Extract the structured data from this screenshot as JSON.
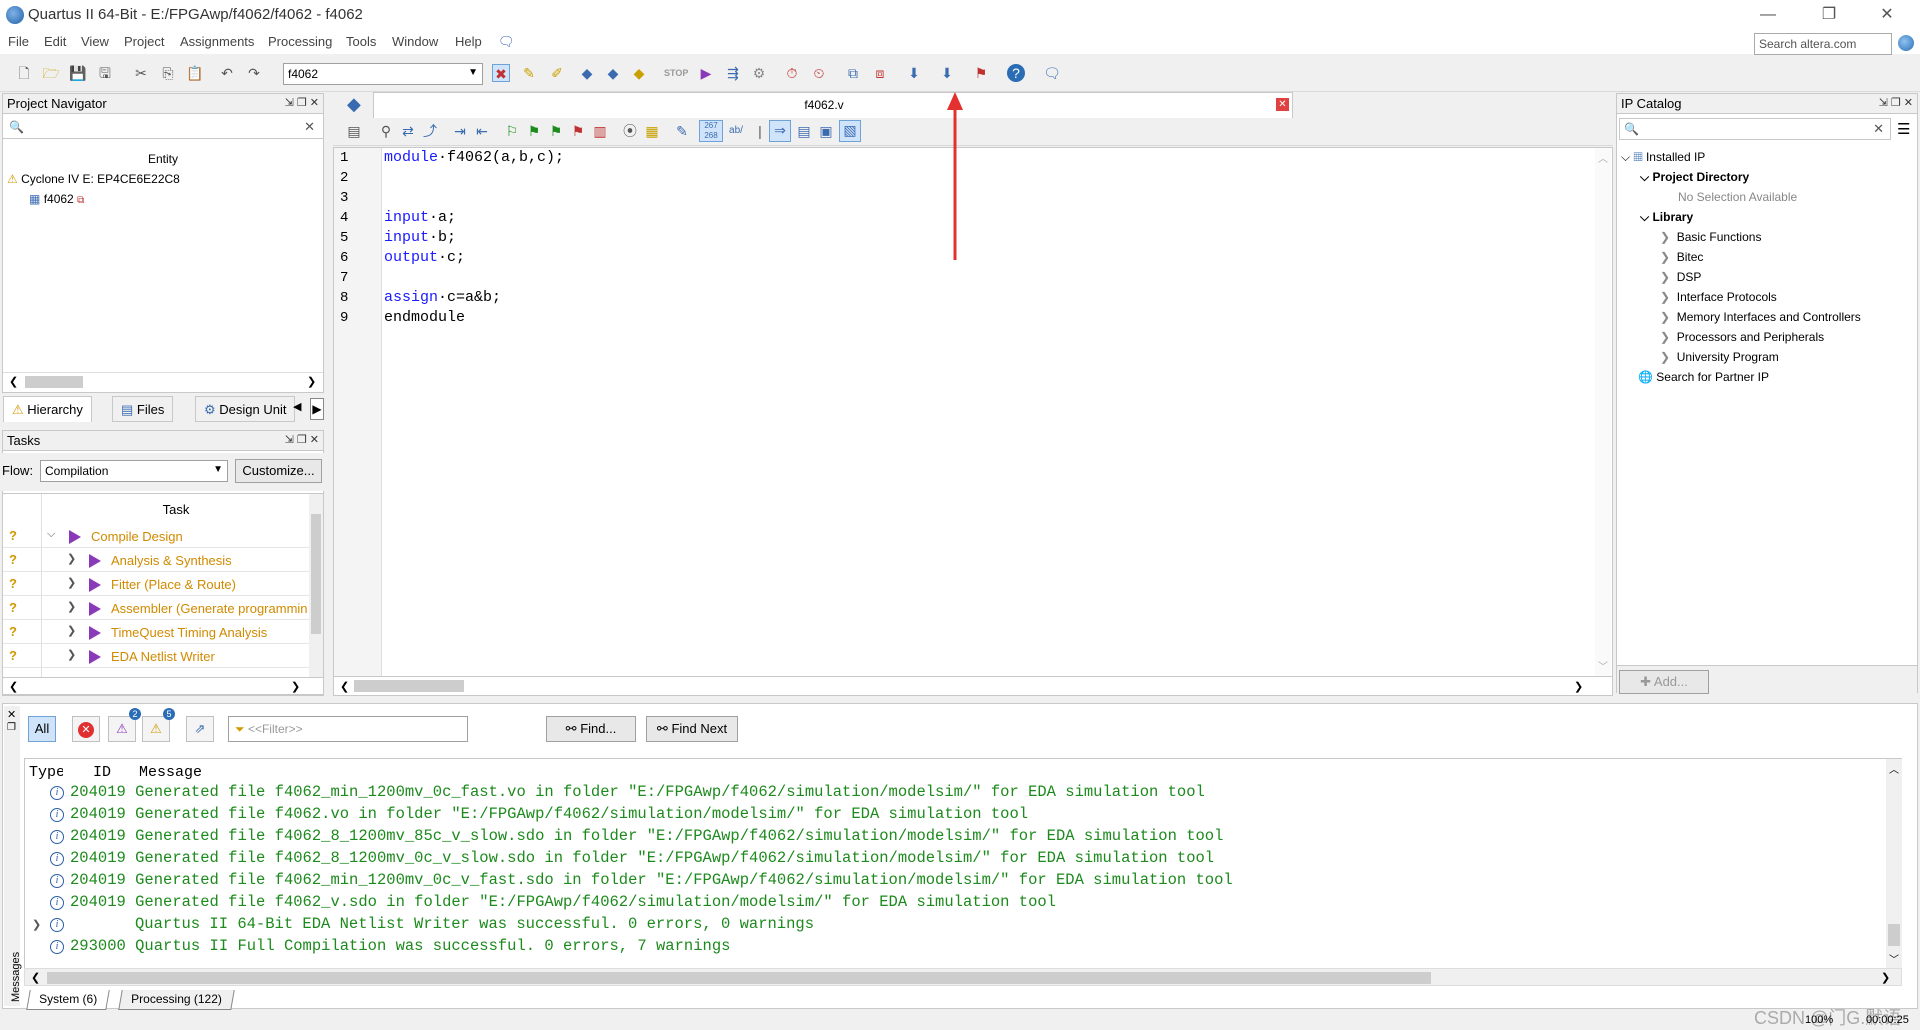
{
  "window": {
    "title": "Quartus II 64-Bit - E:/FPGAwp/f4062/f4062 - f4062",
    "minimize": "—",
    "restore": "❐",
    "close": "✕"
  },
  "menu": [
    "File",
    "Edit",
    "View",
    "Project",
    "Assignments",
    "Processing",
    "Tools",
    "Window",
    "Help"
  ],
  "search": {
    "placeholder": "Search altera.com"
  },
  "toolbar": {
    "revision": "f4062"
  },
  "project_navigator": {
    "title": "Project Navigator",
    "column": "Entity",
    "device": "Cyclone IV E: EP4CE6E22C8",
    "top_entity": "f4062",
    "tabs": [
      "Hierarchy",
      "Files",
      "Design Unit"
    ]
  },
  "tasks": {
    "title": "Tasks",
    "flow_label": "Flow:",
    "flow_value": "Compilation",
    "customize": "Customize...",
    "column": "Task",
    "items": [
      {
        "label": "Compile Design",
        "status": "?"
      },
      {
        "label": "Analysis & Synthesis",
        "status": "?"
      },
      {
        "label": "Fitter (Place & Route)",
        "status": "?"
      },
      {
        "label": "Assembler (Generate programmin",
        "status": "?"
      },
      {
        "label": "TimeQuest Timing Analysis",
        "status": "?"
      },
      {
        "label": "EDA Netlist Writer",
        "status": "?"
      }
    ]
  },
  "editor": {
    "tab": "f4062.v",
    "lines": [
      {
        "n": "1",
        "kw": "module",
        "rest": "·f4062(a,b,c);"
      },
      {
        "n": "2",
        "kw": "",
        "rest": ""
      },
      {
        "n": "3",
        "kw": "",
        "rest": ""
      },
      {
        "n": "4",
        "kw": "input",
        "rest": "·a;"
      },
      {
        "n": "5",
        "kw": "input",
        "rest": "·b;"
      },
      {
        "n": "6",
        "kw": "output",
        "rest": "·c;"
      },
      {
        "n": "7",
        "kw": "",
        "rest": ""
      },
      {
        "n": "8",
        "kw": "assign",
        "rest": "·c=a&b;"
      },
      {
        "n": "9",
        "kw": "",
        "rest": "endmodule"
      }
    ]
  },
  "ip_catalog": {
    "title": "IP Catalog",
    "installed": "Installed IP",
    "project_directory": "Project Directory",
    "no_selection": "No Selection Available",
    "library": "Library",
    "categories": [
      "Basic Functions",
      "Bitec",
      "DSP",
      "Interface Protocols",
      "Memory Interfaces and Controllers",
      "Processors and Peripherals",
      "University Program"
    ],
    "partner": "Search for Partner IP",
    "add": "Add..."
  },
  "messages": {
    "side_label": "Messages",
    "filter_all": "All",
    "badge_warn_crit": "2",
    "badge_warn": "5",
    "filter_placeholder": "<<Filter>>",
    "find": "Find...",
    "find_next": "Find Next",
    "columns": [
      "Type",
      "ID",
      "Message"
    ],
    "rows": [
      {
        "id": "204019",
        "msg": "Generated file f4062_min_1200mv_0c_fast.vo in folder \"E:/FPGAwp/f4062/simulation/modelsim/\" for EDA simulation tool"
      },
      {
        "id": "204019",
        "msg": "Generated file f4062.vo in folder \"E:/FPGAwp/f4062/simulation/modelsim/\" for EDA simulation tool"
      },
      {
        "id": "204019",
        "msg": "Generated file f4062_8_1200mv_85c_v_slow.sdo in folder \"E:/FPGAwp/f4062/simulation/modelsim/\" for EDA simulation tool"
      },
      {
        "id": "204019",
        "msg": "Generated file f4062_8_1200mv_0c_v_slow.sdo in folder \"E:/FPGAwp/f4062/simulation/modelsim/\" for EDA simulation tool"
      },
      {
        "id": "204019",
        "msg": "Generated file f4062_min_1200mv_0c_v_fast.sdo in folder \"E:/FPGAwp/f4062/simulation/modelsim/\" for EDA simulation tool"
      },
      {
        "id": "204019",
        "msg": "Generated file f4062_v.sdo in folder \"E:/FPGAwp/f4062/simulation/modelsim/\" for EDA simulation tool"
      },
      {
        "id": "",
        "msg": "Quartus II 64-Bit EDA Netlist Writer was successful. 0 errors, 0 warnings"
      },
      {
        "id": "293000",
        "msg": "Quartus II Full Compilation was successful. 0 errors, 7 warnings"
      }
    ],
    "tabs": [
      "System (6)",
      "Processing (122)"
    ]
  },
  "status": {
    "zoom": "100%",
    "time": "00:00:25",
    "watermark": "CSDN @门G.默语"
  }
}
